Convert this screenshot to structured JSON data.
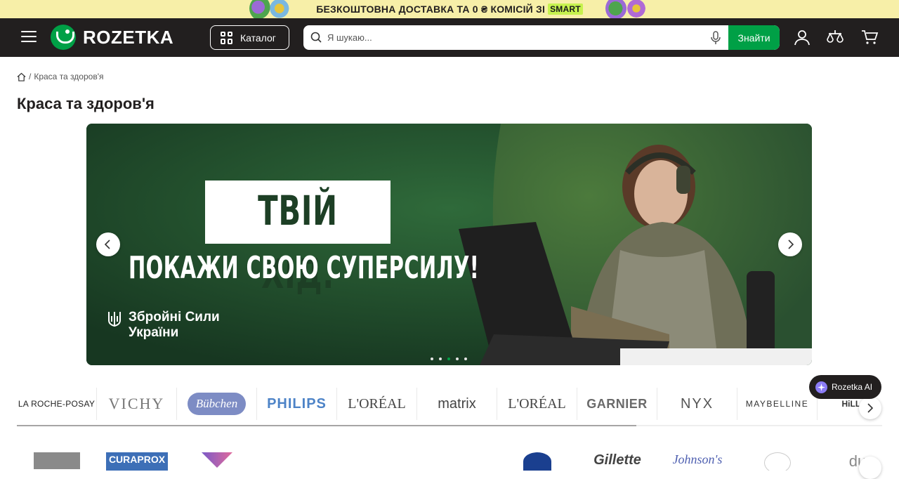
{
  "promo": {
    "text": "БЕЗКОШТОВНА ДОСТАВКА ТА 0 ₴ КОМІСІЙ ЗІ",
    "badge": "SMART"
  },
  "header": {
    "logo_text": "ROZETKA",
    "catalog_label": "Каталог",
    "search_placeholder": "Я шукаю...",
    "search_button": "Знайти",
    "icons": [
      "menu-icon",
      "user-icon",
      "compare-icon",
      "cart-icon"
    ]
  },
  "breadcrumb": {
    "current": "Краса та здоров'я"
  },
  "page": {
    "title": "Краса та здоров'я"
  },
  "banner": {
    "line1": "ТВІЙ ХІД.",
    "line2": "ПОКАЖИ СВОЮ СУПЕРСИЛУ!",
    "org_line1": "Збройні Сили",
    "org_line2": "України",
    "slide_count": 5,
    "active_slide": 3,
    "colors": {
      "bg_dark": "#1d3f25",
      "bg_light": "#2a5a34"
    }
  },
  "brands": [
    {
      "name": "LA ROCHE-POSAY",
      "label": "LA ROCHE-POSAY"
    },
    {
      "name": "VICHY",
      "label": "VICHY"
    },
    {
      "name": "Bübchen",
      "label": "Bübchen"
    },
    {
      "name": "PHILIPS",
      "label": "PHILIPS"
    },
    {
      "name": "L'ORÉAL PROFESSIONNEL",
      "label": "L'ORÉAL"
    },
    {
      "name": "matrix",
      "label": "matrix"
    },
    {
      "name": "L'ORÉAL PARIS",
      "label": "L'ORÉAL"
    },
    {
      "name": "GARNIER",
      "label": "GARNIER"
    },
    {
      "name": "NYX",
      "label": "NYX"
    },
    {
      "name": "MAYBELLINE",
      "label": "MAYBELLINE"
    },
    {
      "name": "HiLLARY",
      "label": "HiLLAR"
    }
  ],
  "second_row_logos": [
    "",
    "CURAPROX",
    "",
    "",
    "",
    "",
    "",
    "Gillette",
    "Johnson's",
    "",
    "du"
  ],
  "ai_assistant": {
    "label": "Rozetka AI"
  },
  "colors": {
    "accent": "#00a046",
    "header_bg": "#221f1f",
    "promo_bg": "#f7efa8"
  }
}
